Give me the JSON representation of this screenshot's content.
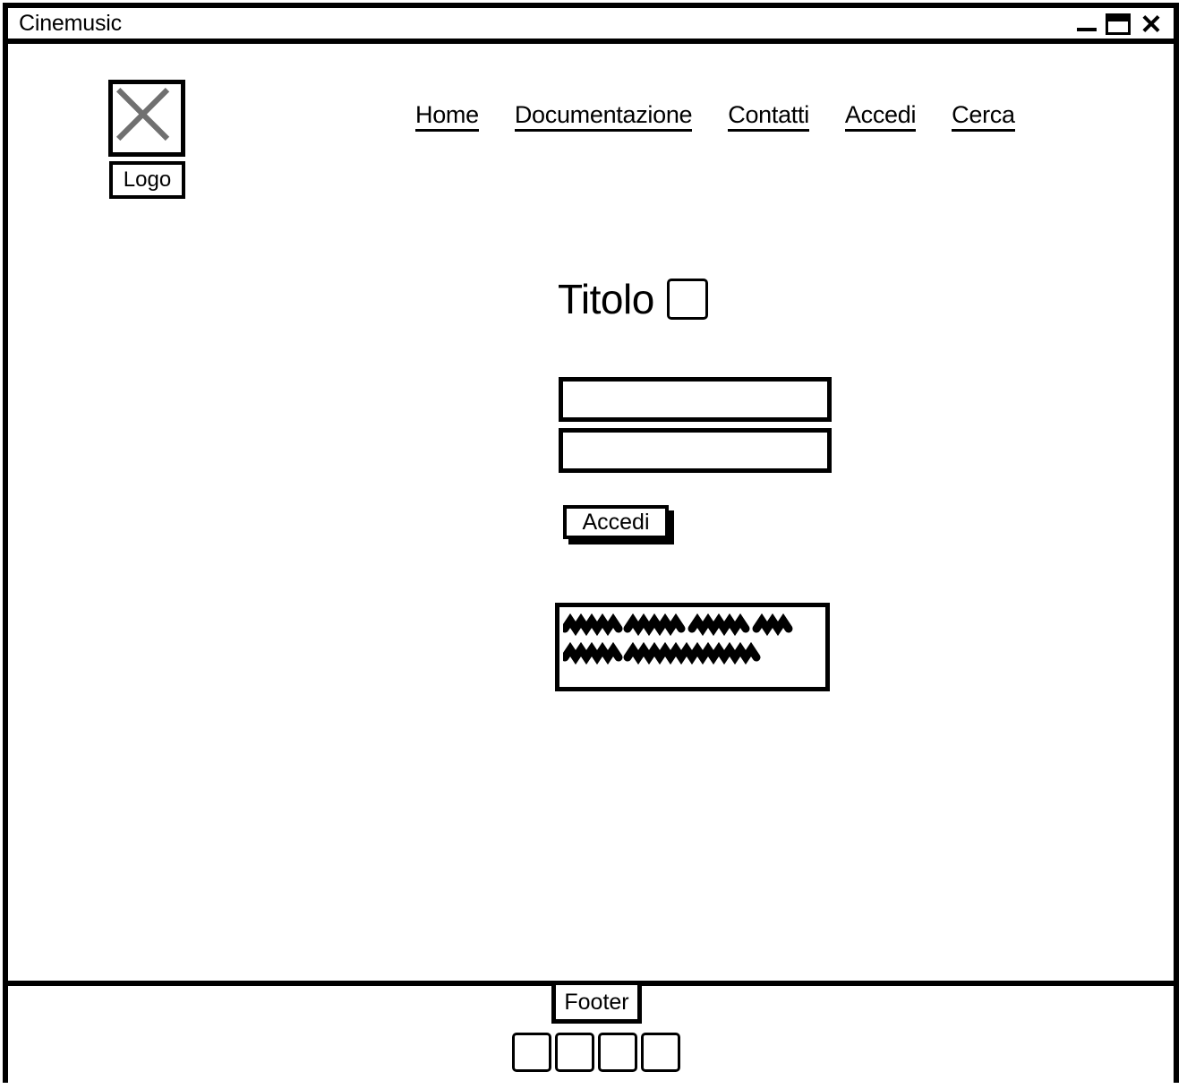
{
  "window": {
    "title": "Cinemusic",
    "controls": [
      {
        "name": "minimize",
        "glyph": "_"
      },
      {
        "name": "maximize",
        "glyph": "□"
      },
      {
        "name": "close",
        "glyph": "×"
      }
    ]
  },
  "header": {
    "logo": {
      "icon": "image-placeholder-x-icon",
      "label": "Logo"
    },
    "nav": [
      {
        "label": "Home"
      },
      {
        "label": "Documentazione"
      },
      {
        "label": "Contatti"
      },
      {
        "label": "Accedi"
      },
      {
        "label": "Cerca"
      }
    ]
  },
  "main": {
    "title": "Titolo",
    "title_checkbox": {
      "checked": false
    },
    "fields": [
      {
        "name": "field-one",
        "value": "",
        "placeholder": ""
      },
      {
        "name": "field-two",
        "value": "",
        "placeholder": ""
      }
    ],
    "submit_button": {
      "label": "Accedi"
    },
    "message_box": {
      "content_type": "scribble-placeholder",
      "lines": [
        {
          "words": [
            60,
            62,
            62,
            34
          ]
        },
        {
          "words": [
            60,
            150
          ]
        }
      ]
    }
  },
  "footer": {
    "label": "Footer",
    "boxes": [
      {
        "name": "footer-box-1"
      },
      {
        "name": "footer-box-2"
      },
      {
        "name": "footer-box-3"
      },
      {
        "name": "footer-box-4"
      }
    ]
  },
  "colors": {
    "ink": "#000000",
    "paper": "#ffffff",
    "placeholder_x": "#707070"
  }
}
